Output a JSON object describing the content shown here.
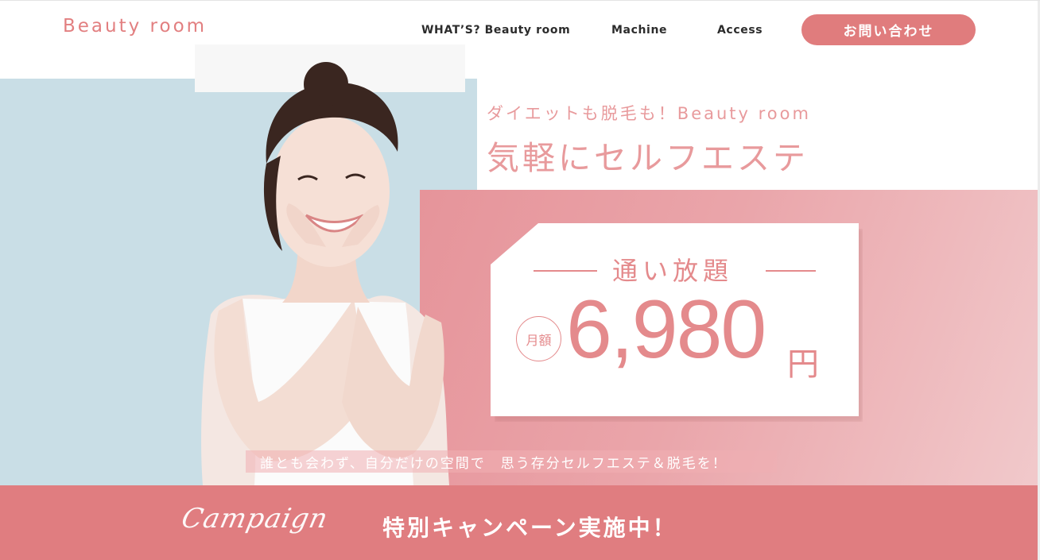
{
  "header": {
    "logo": "Beauty room",
    "nav": [
      {
        "label": "WHAT’S? Beauty room"
      },
      {
        "label": "Machine"
      },
      {
        "label": "Access"
      }
    ],
    "contact_button": "お問い合わせ"
  },
  "hero": {
    "tagline": "ダイエットも脱毛も！Beauty room",
    "headline": "気軽にセルフエステ",
    "image_name": "smiling-woman-photo"
  },
  "price_card": {
    "title": "通い放題",
    "badge": "月額",
    "price": "6,980",
    "unit": "円"
  },
  "subcopy": "誰とも会わず、自分だけの空間で　思う存分セルフエステ＆脱毛を！",
  "campaign": {
    "script": "Campaign",
    "text": "特別キャンペーン実施中！"
  },
  "colors": {
    "accent": "#e07c7d",
    "blue_bg": "#c9dee6",
    "pink_bg": "#e6949a"
  }
}
